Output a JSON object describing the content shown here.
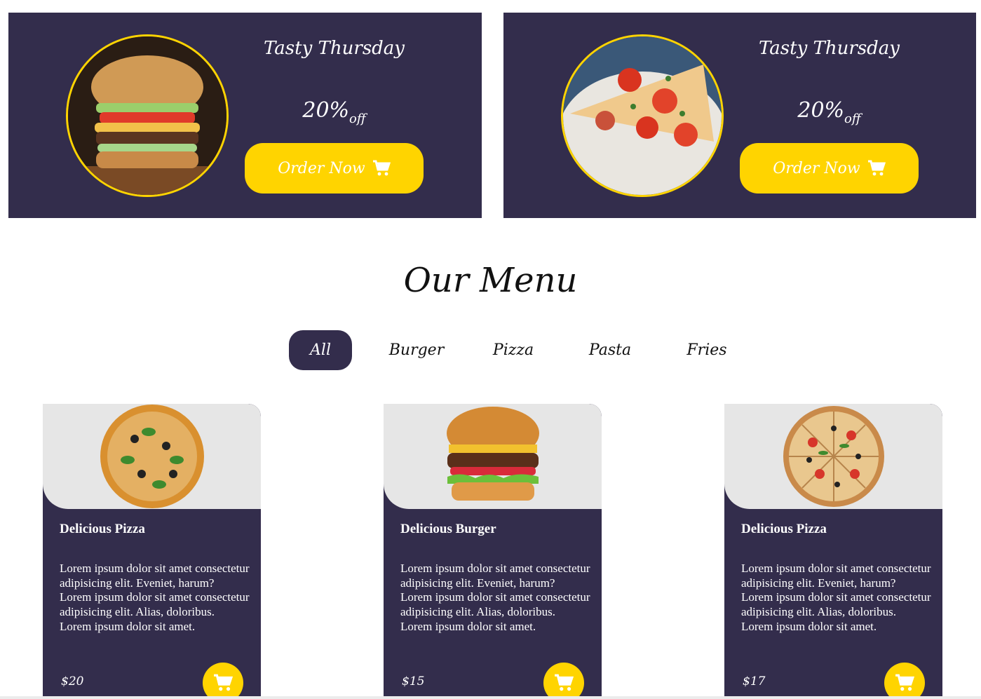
{
  "offers": [
    {
      "title": "Tasty Thursday",
      "percent": "20%",
      "off": "off",
      "button": "Order Now",
      "image": "burger-photo"
    },
    {
      "title": "Tasty Thursday",
      "percent": "20%",
      "off": "off",
      "button": "Order Now",
      "image": "pizza-photo"
    }
  ],
  "menu": {
    "title": "Our Menu",
    "tabs": [
      "All",
      "Burger",
      "Pizza",
      "Pasta",
      "Fries"
    ],
    "active_tab": "All"
  },
  "cards": [
    {
      "name": "Delicious Pizza",
      "desc": [
        "Lorem ipsum dolor sit amet consectetur",
        "adipisicing elit. Eveniet, harum?",
        "Lorem ipsum dolor sit amet consectetur",
        "adipisicing elit. Alias, doloribus.",
        "Lorem ipsum dolor sit amet."
      ],
      "price": "$20",
      "image": "pizza-image"
    },
    {
      "name": "Delicious Burger",
      "desc": [
        "Lorem ipsum dolor sit amet consectetur",
        "adipisicing elit. Eveniet, harum?",
        "Lorem ipsum dolor sit amet consectetur",
        "adipisicing elit. Alias, doloribus.",
        "Lorem ipsum dolor sit amet."
      ],
      "price": "$15",
      "image": "burger-image"
    },
    {
      "name": "Delicious Pizza",
      "desc": [
        "Lorem ipsum dolor sit amet consectetur",
        "adipisicing elit. Eveniet, harum?",
        "Lorem ipsum dolor sit amet consectetur",
        "adipisicing elit. Alias, doloribus.",
        "Lorem ipsum dolor sit amet."
      ],
      "price": "$17",
      "image": "pizza-image"
    }
  ],
  "colors": {
    "primary": "#332d4c",
    "accent": "#ffd400",
    "image_bg": "#e6e6e6"
  },
  "icons": {
    "cart": "shopping-cart-icon"
  }
}
